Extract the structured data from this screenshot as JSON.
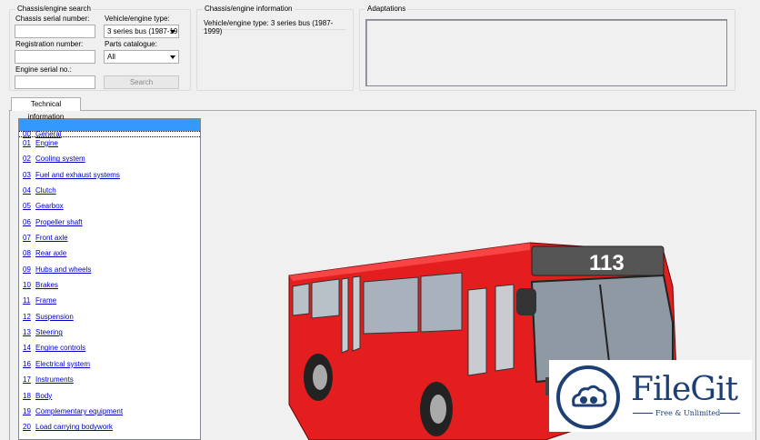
{
  "chassis_search": {
    "title": "Chassis/engine search",
    "serial_label": "Chassis serial number:",
    "serial_value": "",
    "registration_label": "Registration number:",
    "registration_value": "",
    "engine_serial_label": "Engine serial no.:",
    "engine_serial_value": "",
    "vehicle_type_label": "Vehicle/engine type:",
    "vehicle_type_value": "3 series bus (1987-19",
    "parts_catalogue_label": "Parts catalogue:",
    "parts_catalogue_value": "All",
    "search_button": "Search"
  },
  "chassis_info": {
    "title": "Chassis/engine information",
    "text": "Vehicle/engine type: 3 series bus (1987-1999)"
  },
  "adaptations": {
    "title": "Adaptations"
  },
  "tabs": [
    {
      "label": "Technical information"
    }
  ],
  "groups": [
    {
      "code": "00",
      "name": "General"
    },
    {
      "code": "01",
      "name": "Engine"
    },
    {
      "code": "02",
      "name": "Cooling system"
    },
    {
      "code": "03",
      "name": "Fuel and exhaust systems"
    },
    {
      "code": "04",
      "name": "Clutch"
    },
    {
      "code": "05",
      "name": "Gearbox"
    },
    {
      "code": "06",
      "name": "Propeller shaft"
    },
    {
      "code": "07",
      "name": "Front axle"
    },
    {
      "code": "08",
      "name": "Rear axle"
    },
    {
      "code": "09",
      "name": "Hubs and wheels"
    },
    {
      "code": "10",
      "name": "Brakes"
    },
    {
      "code": "11",
      "name": "Frame"
    },
    {
      "code": "12",
      "name": "Suspension"
    },
    {
      "code": "13",
      "name": "Steering"
    },
    {
      "code": "14",
      "name": "Engine controls"
    },
    {
      "code": "16",
      "name": "Electrical system"
    },
    {
      "code": "17",
      "name": "Instruments"
    },
    {
      "code": "18",
      "name": "Body"
    },
    {
      "code": "19",
      "name": "Complementary equipment"
    },
    {
      "code": "20",
      "name": "Load carrying bodywork"
    }
  ],
  "bus_illustration": {
    "route_number": "113",
    "body_color": "#e41e1e"
  },
  "watermark": {
    "brand": "FileGit",
    "tagline": "Free & Unlimited",
    "color": "#1d3f73"
  }
}
